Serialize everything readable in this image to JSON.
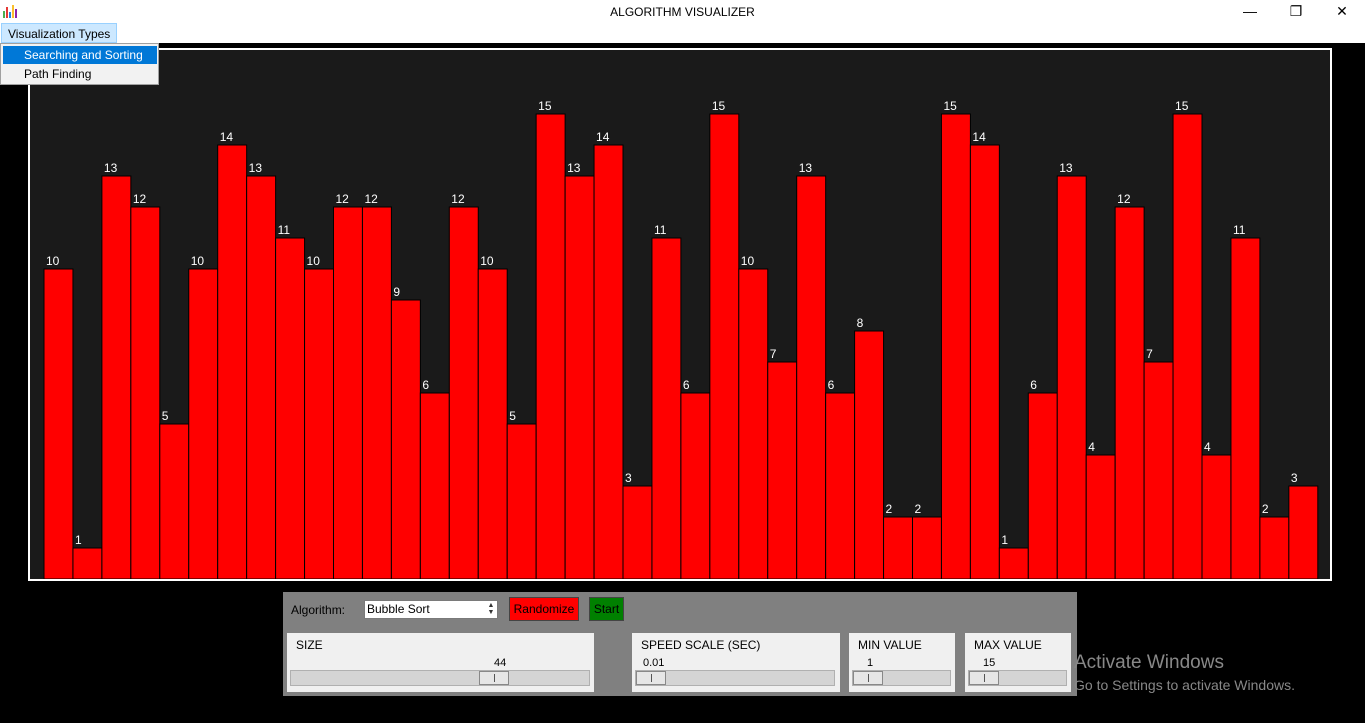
{
  "window": {
    "title": "ALGORITHM VISUALIZER",
    "minimize_glyph": "—",
    "maximize_glyph": "❐",
    "close_glyph": "✕",
    "icon": "bar-chart-icon"
  },
  "menu": {
    "label": "Visualization Types",
    "items": [
      {
        "label": "Searching and Sorting",
        "selected": true
      },
      {
        "label": "Path Finding",
        "selected": false
      }
    ]
  },
  "chart_data": {
    "type": "bar",
    "values": [
      10,
      1,
      13,
      12,
      5,
      10,
      14,
      13,
      11,
      10,
      12,
      12,
      9,
      6,
      12,
      10,
      5,
      15,
      13,
      14,
      3,
      11,
      6,
      15,
      10,
      7,
      13,
      6,
      8,
      2,
      2,
      15,
      14,
      1,
      6,
      13,
      4,
      12,
      7,
      15,
      4,
      11,
      2,
      3
    ],
    "ylim": [
      0,
      15
    ],
    "bar_color": "#ff0000",
    "background": "#1a1a1a",
    "label_color": "#ffffff"
  },
  "controls": {
    "algorithm_label": "Algorithm:",
    "algorithm_value": "Bubble Sort",
    "randomize_label": "Randomize",
    "start_label": "Start",
    "randomize_color": "#ff0000",
    "start_color": "#008000",
    "size": {
      "title": "SIZE",
      "value": "44",
      "fraction": 0.7
    },
    "speed": {
      "title": "SPEED SCALE (SEC)",
      "value": "0.01",
      "fraction": 0.0
    },
    "min": {
      "title": "MIN VALUE",
      "value": "1",
      "fraction": 0.0
    },
    "max": {
      "title": "MAX VALUE",
      "value": "15",
      "fraction": 0.0
    }
  },
  "watermark": {
    "line1": "Activate Windows",
    "line2": "Go to Settings to activate Windows."
  }
}
